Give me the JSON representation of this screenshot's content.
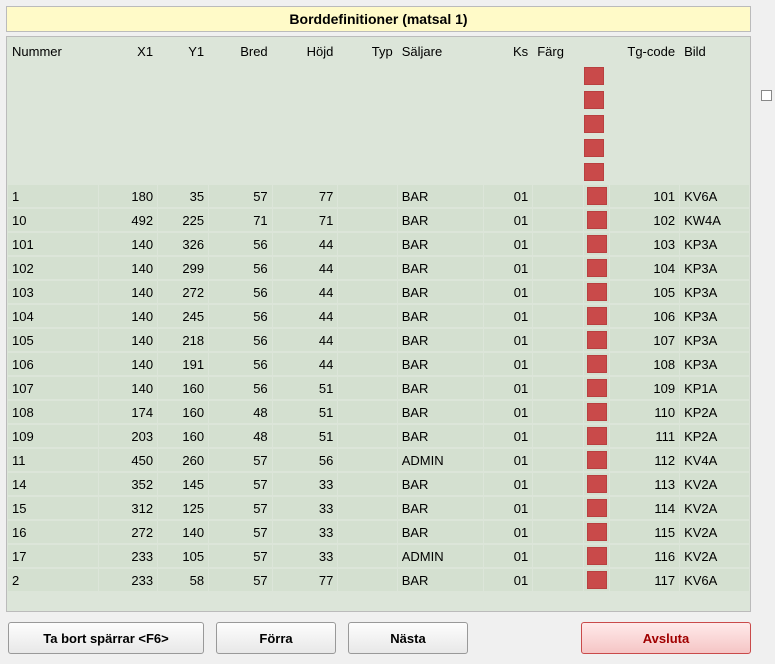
{
  "title": "Borddefinitioner (matsal   1)",
  "columns": {
    "nummer": "Nummer",
    "x1": "X1",
    "y1": "Y1",
    "bred": "Bred",
    "hojd": "Höjd",
    "typ": "Typ",
    "saljare": "Säljare",
    "ks": "Ks",
    "farg": "Färg",
    "tgcode": "Tg-code",
    "bild": "Bild"
  },
  "blank_prefix_rows": 5,
  "color_swatch": "#c94a4a",
  "rows": [
    {
      "nummer": "1",
      "x1": "180",
      "y1": "35",
      "bred": "57",
      "hojd": "77",
      "typ": "",
      "saljare": "BAR",
      "ks": "01",
      "farg": "",
      "tg": "101",
      "bild": "KV6A"
    },
    {
      "nummer": "10",
      "x1": "492",
      "y1": "225",
      "bred": "71",
      "hojd": "71",
      "typ": "",
      "saljare": "BAR",
      "ks": "01",
      "farg": "",
      "tg": "102",
      "bild": "KW4A"
    },
    {
      "nummer": "101",
      "x1": "140",
      "y1": "326",
      "bred": "56",
      "hojd": "44",
      "typ": "",
      "saljare": "BAR",
      "ks": "01",
      "farg": "",
      "tg": "103",
      "bild": "KP3A"
    },
    {
      "nummer": "102",
      "x1": "140",
      "y1": "299",
      "bred": "56",
      "hojd": "44",
      "typ": "",
      "saljare": "BAR",
      "ks": "01",
      "farg": "",
      "tg": "104",
      "bild": "KP3A"
    },
    {
      "nummer": "103",
      "x1": "140",
      "y1": "272",
      "bred": "56",
      "hojd": "44",
      "typ": "",
      "saljare": "BAR",
      "ks": "01",
      "farg": "",
      "tg": "105",
      "bild": "KP3A"
    },
    {
      "nummer": "104",
      "x1": "140",
      "y1": "245",
      "bred": "56",
      "hojd": "44",
      "typ": "",
      "saljare": "BAR",
      "ks": "01",
      "farg": "",
      "tg": "106",
      "bild": "KP3A"
    },
    {
      "nummer": "105",
      "x1": "140",
      "y1": "218",
      "bred": "56",
      "hojd": "44",
      "typ": "",
      "saljare": "BAR",
      "ks": "01",
      "farg": "",
      "tg": "107",
      "bild": "KP3A"
    },
    {
      "nummer": "106",
      "x1": "140",
      "y1": "191",
      "bred": "56",
      "hojd": "44",
      "typ": "",
      "saljare": "BAR",
      "ks": "01",
      "farg": "",
      "tg": "108",
      "bild": "KP3A"
    },
    {
      "nummer": "107",
      "x1": "140",
      "y1": "160",
      "bred": "56",
      "hojd": "51",
      "typ": "",
      "saljare": "BAR",
      "ks": "01",
      "farg": "",
      "tg": "109",
      "bild": "KP1A"
    },
    {
      "nummer": "108",
      "x1": "174",
      "y1": "160",
      "bred": "48",
      "hojd": "51",
      "typ": "",
      "saljare": "BAR",
      "ks": "01",
      "farg": "",
      "tg": "110",
      "bild": "KP2A"
    },
    {
      "nummer": "109",
      "x1": "203",
      "y1": "160",
      "bred": "48",
      "hojd": "51",
      "typ": "",
      "saljare": "BAR",
      "ks": "01",
      "farg": "",
      "tg": "111",
      "bild": "KP2A"
    },
    {
      "nummer": "11",
      "x1": "450",
      "y1": "260",
      "bred": "57",
      "hojd": "56",
      "typ": "",
      "saljare": "ADMIN",
      "ks": "01",
      "farg": "",
      "tg": "112",
      "bild": "KV4A"
    },
    {
      "nummer": "14",
      "x1": "352",
      "y1": "145",
      "bred": "57",
      "hojd": "33",
      "typ": "",
      "saljare": "BAR",
      "ks": "01",
      "farg": "",
      "tg": "113",
      "bild": "KV2A"
    },
    {
      "nummer": "15",
      "x1": "312",
      "y1": "125",
      "bred": "57",
      "hojd": "33",
      "typ": "",
      "saljare": "BAR",
      "ks": "01",
      "farg": "",
      "tg": "114",
      "bild": "KV2A"
    },
    {
      "nummer": "16",
      "x1": "272",
      "y1": "140",
      "bred": "57",
      "hojd": "33",
      "typ": "",
      "saljare": "BAR",
      "ks": "01",
      "farg": "",
      "tg": "115",
      "bild": "KV2A"
    },
    {
      "nummer": "17",
      "x1": "233",
      "y1": "105",
      "bred": "57",
      "hojd": "33",
      "typ": "",
      "saljare": "ADMIN",
      "ks": "01",
      "farg": "",
      "tg": "116",
      "bild": "KV2A"
    },
    {
      "nummer": "2",
      "x1": "233",
      "y1": "58",
      "bred": "57",
      "hojd": "77",
      "typ": "",
      "saljare": "BAR",
      "ks": "01",
      "farg": "",
      "tg": "117",
      "bild": "KV6A"
    }
  ],
  "buttons": {
    "remove_locks": "Ta bort spärrar <F6>",
    "previous": "Förra",
    "next": "Nästa",
    "close": "Avsluta"
  }
}
